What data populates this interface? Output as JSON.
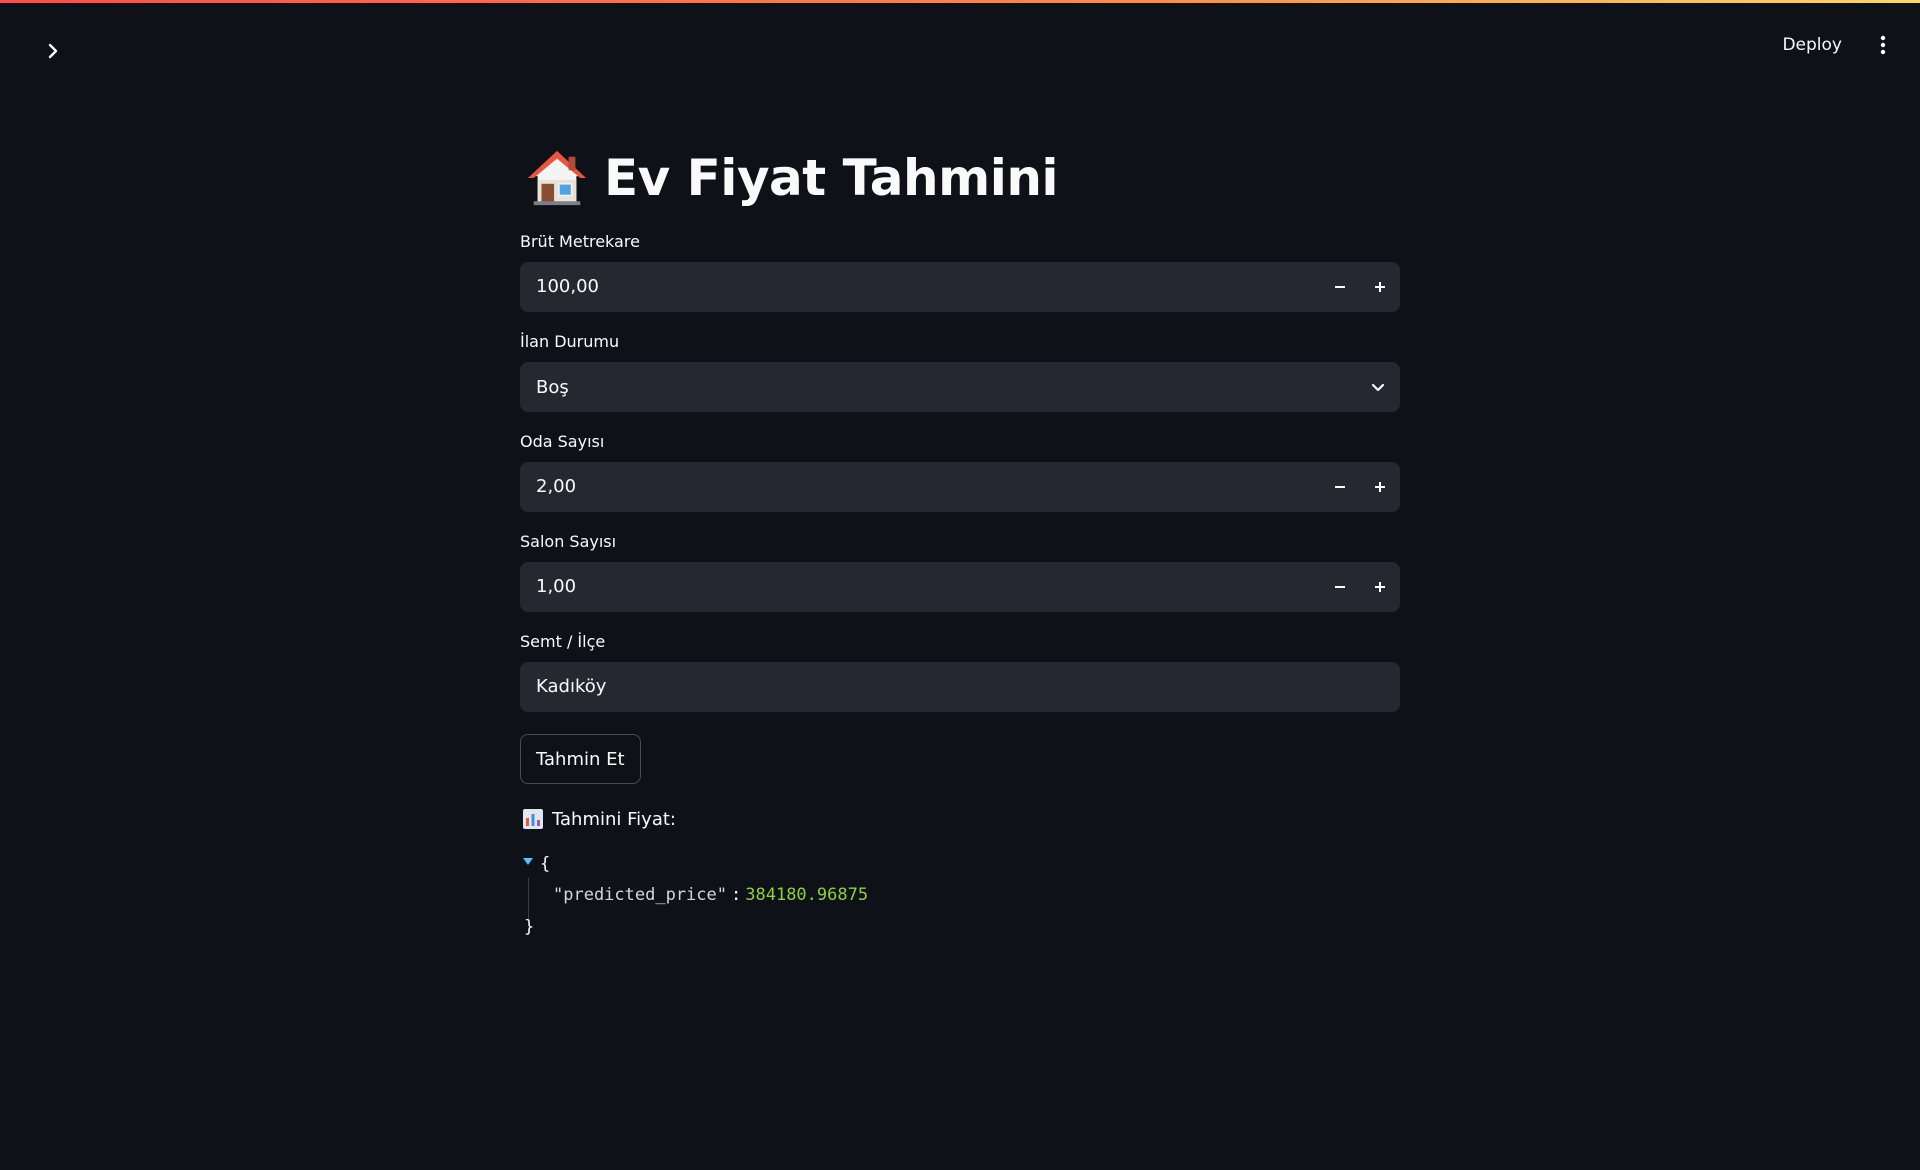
{
  "toolbar": {
    "deploy_label": "Deploy"
  },
  "icons": {
    "sidebar_toggle": "chevron-right-icon",
    "menu": "vertical-ellipsis-icon",
    "title": "house-icon",
    "result": "bar-chart-icon"
  },
  "colors": {
    "background": "#0e1117",
    "input_bg": "#262730",
    "accent_start": "#ff4b4b",
    "accent_end": "#fdd663",
    "json_number": "#8ed13c",
    "json_caret": "#4fc3f7"
  },
  "main": {
    "title": "Ev Fiyat Tahmini",
    "fields": {
      "area": {
        "label": "Brüt Metrekare",
        "value": "100,00"
      },
      "status": {
        "label": "İlan Durumu",
        "value": "Boş"
      },
      "rooms": {
        "label": "Oda Sayısı",
        "value": "2,00"
      },
      "halls": {
        "label": "Salon Sayısı",
        "value": "1,00"
      },
      "district": {
        "label": "Semt / İlçe",
        "value": "Kadıköy"
      }
    },
    "predict_button": "Tahmin Et",
    "result": {
      "heading": "Tahmini Fiyat:",
      "json_open": "{",
      "json_key": "\"predicted_price\"",
      "json_colon": ":",
      "json_value": "384180.96875",
      "json_close": "}"
    }
  }
}
